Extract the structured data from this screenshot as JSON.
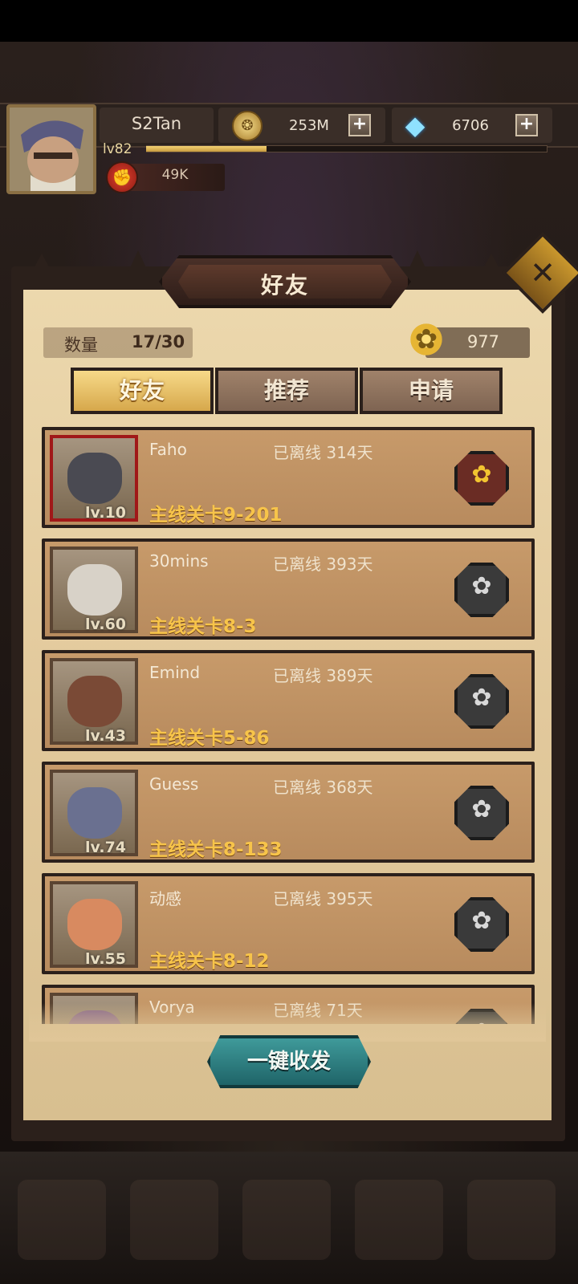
{
  "player": {
    "name": "S2Tan",
    "level": "lv82",
    "xp_fraction": 0.3,
    "power": "49K"
  },
  "currencies": {
    "gold": "253M",
    "gems": "6706"
  },
  "panel": {
    "title": "好友",
    "count_label": "数量",
    "count_value": "17/30",
    "friendship_points": "977",
    "tabs": [
      {
        "label": "好友",
        "active": true
      },
      {
        "label": "推荐",
        "active": false
      },
      {
        "label": "申请",
        "active": false
      }
    ]
  },
  "friends": [
    {
      "name": "Faho",
      "status": "已离线 314天",
      "stage": "主线关卡9-201",
      "level": "lv.10",
      "gift_active": true,
      "face_color": "#4a4a52"
    },
    {
      "name": "30mins",
      "status": "已离线 393天",
      "stage": "主线关卡8-3",
      "level": "lv.60",
      "gift_active": false,
      "face_color": "#d8d2c8"
    },
    {
      "name": "Emind",
      "status": "已离线 389天",
      "stage": "主线关卡5-86",
      "level": "lv.43",
      "gift_active": false,
      "face_color": "#7a4a36"
    },
    {
      "name": "Guess",
      "status": "已离线 368天",
      "stage": "主线关卡8-133",
      "level": "lv.74",
      "gift_active": false,
      "face_color": "#6a7090"
    },
    {
      "name": "动感",
      "status": "已离线 395天",
      "stage": "主线关卡8-12",
      "level": "lv.55",
      "gift_active": false,
      "face_color": "#d88a60"
    },
    {
      "name": "Vorya",
      "status": "已离线 71天",
      "stage": "",
      "level": "",
      "gift_active": false,
      "face_color": "#8a6a8a"
    }
  ],
  "buttons": {
    "send_all": "一键收发",
    "plus": "+",
    "close": "✕"
  },
  "icons": {
    "coin": "coin-icon",
    "gem": "gem-icon",
    "power": "fist-icon",
    "flower": "flower-icon",
    "gift": "flower-gift-icon"
  }
}
